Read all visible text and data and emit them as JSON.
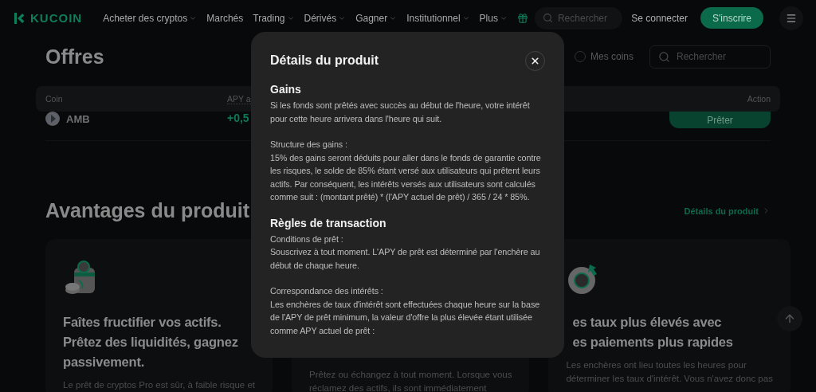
{
  "nav": {
    "logo": "KUCOIN",
    "menu": [
      {
        "label": "Acheter des cryptos",
        "dropdown": true
      },
      {
        "label": "Marchés",
        "dropdown": false
      },
      {
        "label": "Trading",
        "dropdown": true
      },
      {
        "label": "Dérivés",
        "dropdown": true
      },
      {
        "label": "Gagner",
        "dropdown": true
      },
      {
        "label": "Institutionnel",
        "dropdown": true
      },
      {
        "label": "Plus",
        "dropdown": true
      }
    ],
    "search": {
      "placeholder": "Rechercher"
    },
    "login": "Se connecter",
    "signup": "S'inscrire"
  },
  "offers": {
    "title": "Offres",
    "my_coins": {
      "label": "Mes coins",
      "checked": false
    },
    "search": {
      "placeholder": "Rechercher"
    },
    "columns": [
      "Coin",
      "APY a",
      "Action"
    ],
    "rows": [
      {
        "coin": "AMB",
        "apy": "+0,5",
        "action": "Prêter"
      }
    ]
  },
  "benefits": {
    "title": "Avantages du produit",
    "link": "Détails du produit",
    "cards": [
      {
        "kind": "savings",
        "title": [
          "Faîtes fructifier vos actifs.",
          "Prêtez des liquidités, gagnez",
          "passivement."
        ],
        "text": [
          "Le prêt de cryptos Pro est sûr, à faible risque et"
        ]
      },
      {
        "kind": "hidden",
        "text": [
          "Prêtez ou échangez à tout moment. Lorsque vous",
          "réclamez des actifs, ils sont immédiatement"
        ]
      },
      {
        "kind": "rate",
        "title": [
          "es taux plus élevés avec",
          "es paiements plus rapides"
        ],
        "text": [
          "Les enchères ont lieu toutes les heures pour",
          "déterminer les taux d'intérêt. Vous n'avez donc pas"
        ]
      }
    ]
  },
  "modal": {
    "title": "Détails du produit",
    "sections": [
      {
        "heading": "Gains",
        "blocks": [
          {
            "text": "Si les fonds sont prêtés avec succès au début de l'heure, votre intérêt pour cette heure arrivera dans l'heure qui suit."
          },
          {
            "label": "Structure des gains :",
            "text": "15% des gains seront déduits pour aller dans le fonds de garantie contre les risques, le solde de 85% étant versé aux utilisateurs qui prêtent leurs actifs. Par conséquent, les intérêts versés aux utilisateurs sont calculés comme suit : (montant prêté) * (l'APY actuel de prêt) / 365 / 24 * 85%."
          }
        ]
      },
      {
        "heading": "Règles de transaction",
        "blocks": [
          {
            "label": "Conditions de prêt :",
            "text": "Souscrivez à tout moment. L'APY de prêt est déterminé par l'enchère au début de chaque heure."
          },
          {
            "label": "Correspondance des intérêts :",
            "text": "Les enchères de taux d'intérêt sont effectuées chaque heure sur la base de l'APY de prêt minimum, la valeur d'offre la plus élevée étant utilisée comme APY actuel de prêt :"
          }
        ]
      }
    ]
  }
}
